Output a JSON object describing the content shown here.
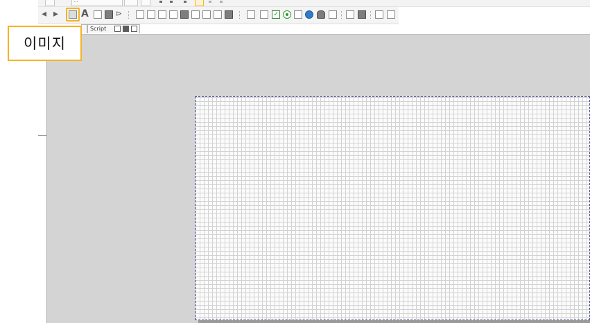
{
  "toolbar": {
    "font_field_value": "...",
    "image_tool_name": "image-tool",
    "icons": [
      "back-icon",
      "forward-icon",
      "image-icon",
      "text-icon",
      "field-icon",
      "picture-icon",
      "line-icon",
      "form-icon",
      "memo-icon",
      "chart-icon",
      "barcode-icon",
      "frame-icon",
      "print-icon",
      "page-icon",
      "list-icon",
      "section-icon",
      "label-icon",
      "summary-icon",
      "checkbox-icon",
      "radio-icon",
      "combo-icon",
      "globe-icon",
      "user-icon",
      "pen-icon",
      "a-icon",
      "table-icon",
      "graph-icon",
      "chart2-icon"
    ]
  },
  "tabs": {
    "script_label": "Script"
  },
  "callout": {
    "label": "이미지",
    "accent_color": "#f5b323"
  },
  "canvas": {
    "background_color": "#d4d4d4",
    "page_color": "#fbfbfb",
    "grid_color": "#d2d2d2"
  }
}
